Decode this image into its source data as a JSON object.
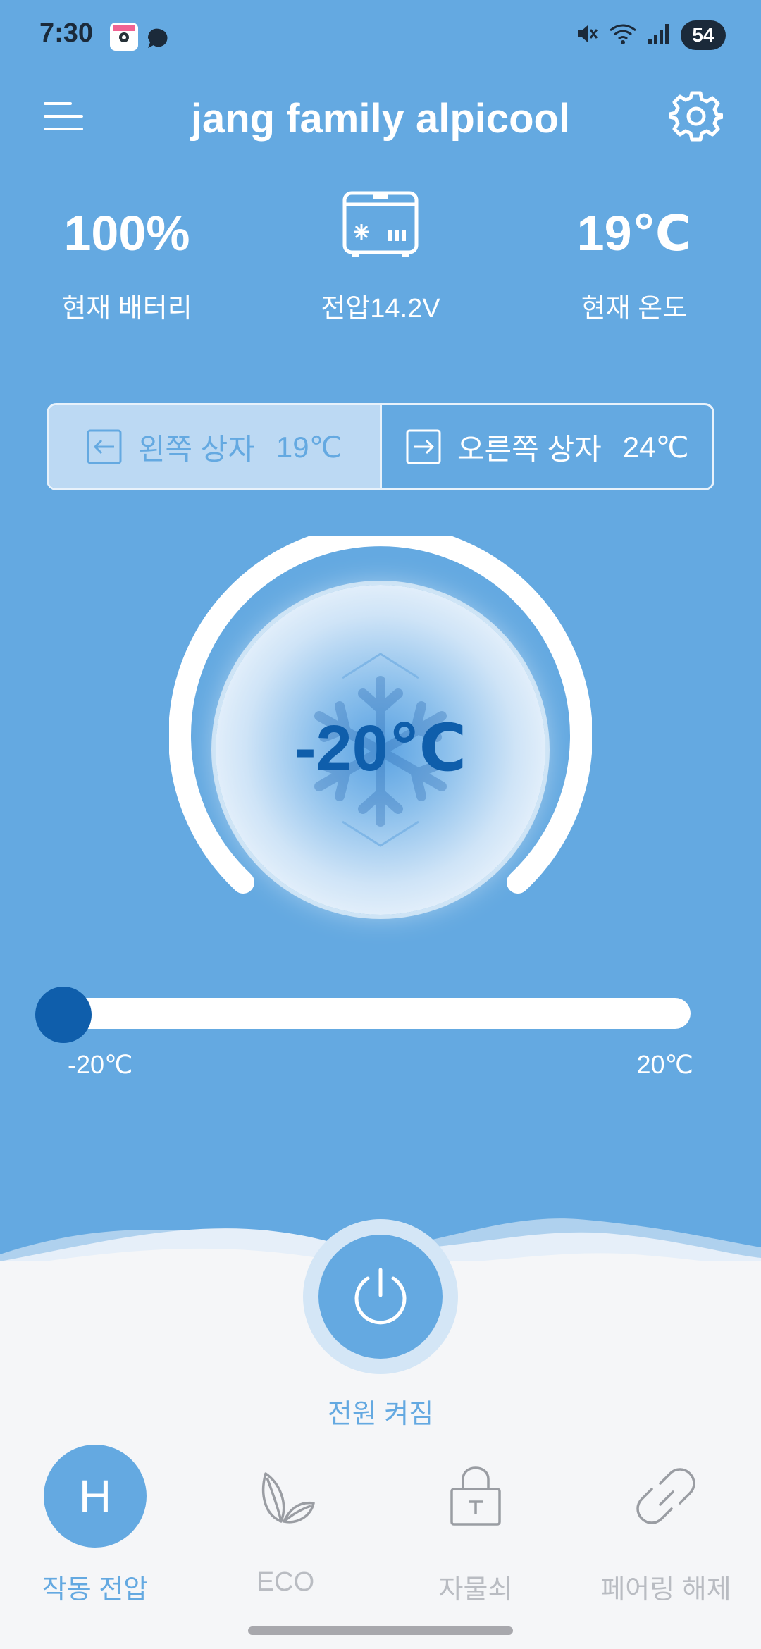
{
  "status_bar": {
    "time": "7:30",
    "battery": "54"
  },
  "header": {
    "title": "jang family alpicool"
  },
  "stats": {
    "battery_value": "100%",
    "battery_label": "현재 배터리",
    "voltage_label": "전압14.2V",
    "temp_value": "19℃",
    "temp_label": "현재 온도"
  },
  "zones": {
    "left_label": "왼쪽 상자",
    "left_temp": "19℃",
    "right_label": "오른쪽 상자",
    "right_temp": "24℃",
    "selected": "left"
  },
  "dial": {
    "target_temp": "-20℃",
    "target_value": -20
  },
  "slider": {
    "min_label": "-20℃",
    "max_label": "20℃",
    "min": -20,
    "max": 20,
    "value": -20
  },
  "power": {
    "label": "전원 켜짐"
  },
  "tabs": [
    {
      "id": "operating-voltage",
      "icon_text": "H",
      "label": "작동 전압",
      "active": true,
      "icon": "h-badge-icon"
    },
    {
      "id": "eco",
      "label": "ECO",
      "active": false,
      "icon": "leaf-icon"
    },
    {
      "id": "lock",
      "label": "자물쇠",
      "active": false,
      "icon": "lock-icon"
    },
    {
      "id": "unpair",
      "label": "페어링 해제",
      "active": false,
      "icon": "unlink-icon"
    }
  ],
  "colors": {
    "background": "#64a9e1",
    "accent_dark": "#0f5eab",
    "panel": "#f5f6f8",
    "inactive": "#b9bcc2"
  }
}
